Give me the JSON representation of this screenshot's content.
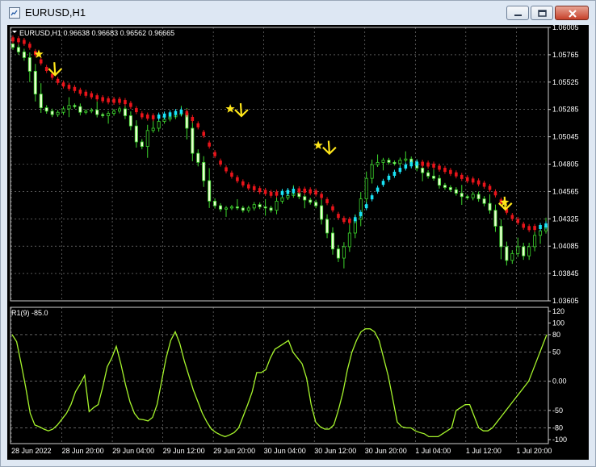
{
  "window": {
    "title": "EURUSD,H1"
  },
  "main_panel": {
    "info": "EURUSD,H1  0.96638 0.96683 0.96562 0.96665"
  },
  "indicator_panel": {
    "label": "R1(9) -85.0"
  },
  "chart_data": [
    {
      "type": "candlestick",
      "symbol": "EURUSD",
      "timeframe": "H1",
      "ohlc": [
        0.96638,
        0.96683,
        0.96562,
        0.96665
      ],
      "y_ticks": [
        "1.06005",
        "1.05765",
        "1.05525",
        "1.05285",
        "1.05045",
        "1.04805",
        "1.04565",
        "1.04325",
        "1.04085",
        "1.03845",
        "1.03605"
      ],
      "ylim": [
        1.03605,
        1.06005
      ],
      "x_ticks": [
        "28 Jun 2022",
        "28 Jun 20:00",
        "29 Jun 04:00",
        "29 Jun 12:00",
        "29 Jun 20:00",
        "30 Jun 04:00",
        "30 Jun 12:00",
        "30 Jun 20:00",
        "1 Jul 04:00",
        "1 Jul 12:00",
        "1 Jul 20:00"
      ],
      "grid": true,
      "close": [
        1.0583,
        1.0579,
        1.0574,
        1.0562,
        1.0542,
        1.053,
        1.0527,
        1.0524,
        1.0526,
        1.0529,
        1.0532,
        1.0531,
        1.0526,
        1.0527,
        1.0528,
        1.0524,
        1.0523,
        1.0525,
        1.0527,
        1.0529,
        1.0523,
        1.0514,
        1.05,
        1.0496,
        1.051,
        1.0512,
        1.0518,
        1.052,
        1.0522,
        1.0524,
        1.0525,
        1.0512,
        1.049,
        1.0482,
        1.0466,
        1.0448,
        1.0444,
        1.0441,
        1.0442,
        1.0443,
        1.0442,
        1.044,
        1.0442,
        1.0445,
        1.0443,
        1.0442,
        1.044,
        1.0448,
        1.0451,
        1.0453,
        1.0455,
        1.0452,
        1.0449,
        1.0447,
        1.0444,
        1.0432,
        1.042,
        1.0406,
        1.0398,
        1.0408,
        1.042,
        1.0432,
        1.045,
        1.0468,
        1.048,
        1.0482,
        1.0484,
        1.0482,
        1.0481,
        1.0484,
        1.0485,
        1.0482,
        1.0477,
        1.0473,
        1.047,
        1.0468,
        1.0462,
        1.046,
        1.0458,
        1.0455,
        1.0452,
        1.0451,
        1.0454,
        1.045,
        1.0446,
        1.044,
        1.0426,
        1.0408,
        1.0396,
        1.0402,
        1.0408,
        1.04,
        1.0408,
        1.0418,
        1.0422,
        1.0426
      ],
      "signals": [
        {
          "index": 5,
          "type": "star",
          "price": 1.0577
        },
        {
          "index": 8,
          "type": "sell-arrow",
          "price": 1.0565
        },
        {
          "index": 42,
          "type": "star",
          "price": 1.0529
        },
        {
          "index": 44,
          "type": "sell-arrow",
          "price": 1.0529
        },
        {
          "index": 59,
          "type": "star",
          "price": 1.0497
        },
        {
          "index": 61,
          "type": "sell-arrow",
          "price": 1.0496
        },
        {
          "index": 101,
          "type": "star",
          "price": 1.0447
        },
        {
          "index": 103,
          "type": "sell-arrow",
          "price": 1.0447
        }
      ]
    },
    {
      "type": "line",
      "name": "R1(9)",
      "value": -85.0,
      "y_ticks": [
        "120",
        "100",
        "80",
        "50",
        "0.00",
        "-50",
        "-80",
        "-100"
      ],
      "ylim": [
        -100,
        120
      ],
      "levels": [
        80,
        50,
        -50,
        -80
      ],
      "grid": true,
      "color": "#a6f52c",
      "values": [
        80,
        68,
        30,
        -10,
        -55,
        -75,
        -78,
        -82,
        -85,
        -82,
        -75,
        -65,
        -55,
        -40,
        -18,
        -5,
        10,
        -52,
        -45,
        -40,
        -10,
        25,
        40,
        60,
        30,
        -5,
        -35,
        -55,
        -65,
        -66,
        -68,
        -62,
        -40,
        0,
        40,
        70,
        85,
        65,
        35,
        10,
        -15,
        -35,
        -55,
        -70,
        -82,
        -88,
        -92,
        -95,
        -92,
        -88,
        -80,
        -60,
        -40,
        -18,
        15,
        15,
        20,
        40,
        55,
        60,
        65,
        70,
        50,
        40,
        30,
        5,
        -40,
        -70,
        -78,
        -82,
        -82,
        -75,
        -50,
        -20,
        20,
        50,
        70,
        85,
        90,
        90,
        85,
        70,
        40,
        10,
        -30,
        -70,
        -78,
        -80,
        -80,
        -85,
        -88,
        -90,
        -95,
        -95,
        -95,
        -90,
        -85,
        -80,
        -50,
        -45,
        -40,
        -40,
        -60,
        -80,
        -85,
        -85,
        -80,
        -70,
        -60,
        -50,
        -40,
        -30,
        -20,
        -10,
        0,
        20,
        40,
        60,
        80
      ]
    }
  ]
}
